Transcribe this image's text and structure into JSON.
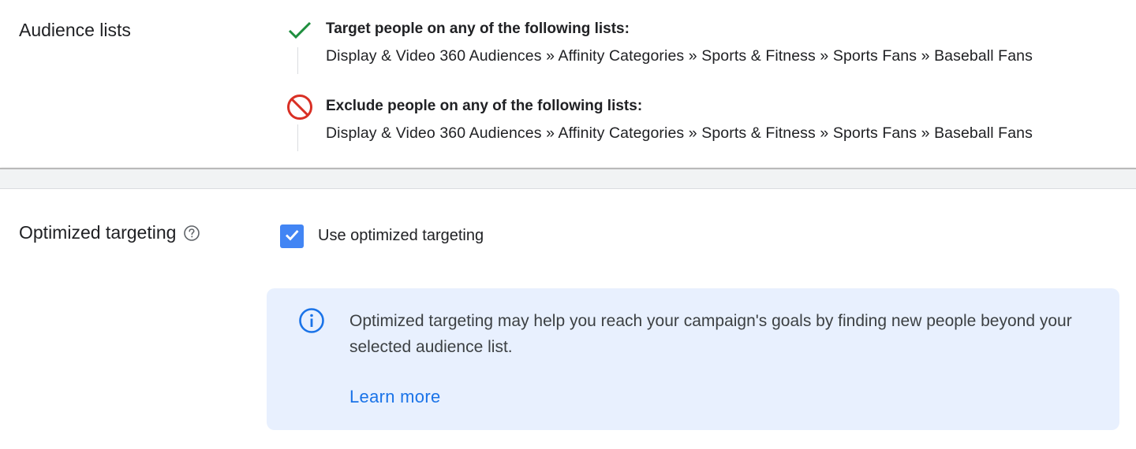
{
  "audience": {
    "label": "Audience lists",
    "include": {
      "title": "Target people on any of the following lists:",
      "path": "Display & Video 360 Audiences » Affinity Categories » Sports & Fitness » Sports Fans » Baseball Fans",
      "icon": "check-icon",
      "color": "#1e8e3e"
    },
    "exclude": {
      "title": "Exclude people on any of the following lists:",
      "path": "Display & Video 360 Audiences » Affinity Categories » Sports & Fitness » Sports Fans » Baseball Fans",
      "icon": "block-icon",
      "color": "#d93025"
    }
  },
  "optimized": {
    "label": "Optimized targeting",
    "help_icon": "help-circle-icon",
    "checkbox_label": "Use optimized targeting",
    "checked": true,
    "checkbox_color": "#4285f4",
    "info": {
      "icon": "info-icon",
      "text": "Optimized targeting may help you reach your campaign's goals by finding new people beyond your selected audience list.",
      "link": "Learn more",
      "background": "#e8f0fe",
      "link_color": "#1a73e8"
    }
  }
}
